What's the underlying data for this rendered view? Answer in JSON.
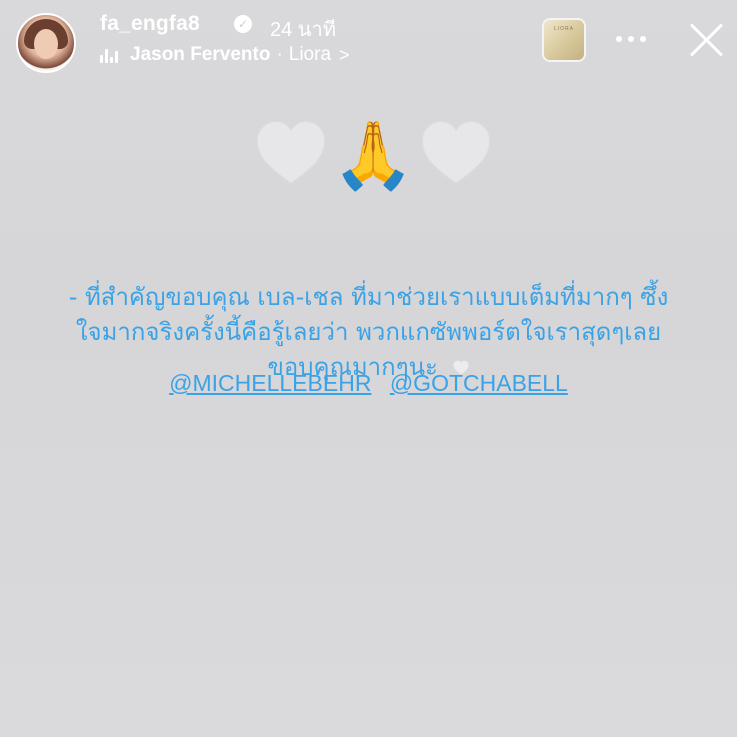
{
  "header": {
    "username": "fa_engfa8",
    "verified_icon": "verified-badge-icon",
    "time": "24 นาที",
    "music": {
      "icon": "music-bars-icon",
      "artist": "Jason Fervento",
      "separator": "·",
      "album": "Liora",
      "chevron": ">"
    },
    "album_art_label": "LIORA",
    "more_icon": "more-options-icon",
    "close_icon": "close-icon"
  },
  "story": {
    "emojis": [
      "white-heart-icon",
      "folded-hands-icon",
      "white-heart-icon"
    ],
    "lines": [
      "- ที่สำคัญขอบคุณ เบล-เชล ที่มาช่วยเราแบบเต็มที่มากๆ ซึ้ง",
      "ใจมากจริงครั้งนี้คือรู้เลยว่า พวกแกซัพพอร์ตใจเราสุดๆเลย",
      "ขอบคุณมากๆนะ"
    ],
    "mentions": [
      "@MICHELLEBEHR",
      "@GOTCHABELL"
    ]
  },
  "colors": {
    "background": "#d8d8da",
    "text_accent": "#3aa2e6",
    "header_text": "#ffffff"
  }
}
